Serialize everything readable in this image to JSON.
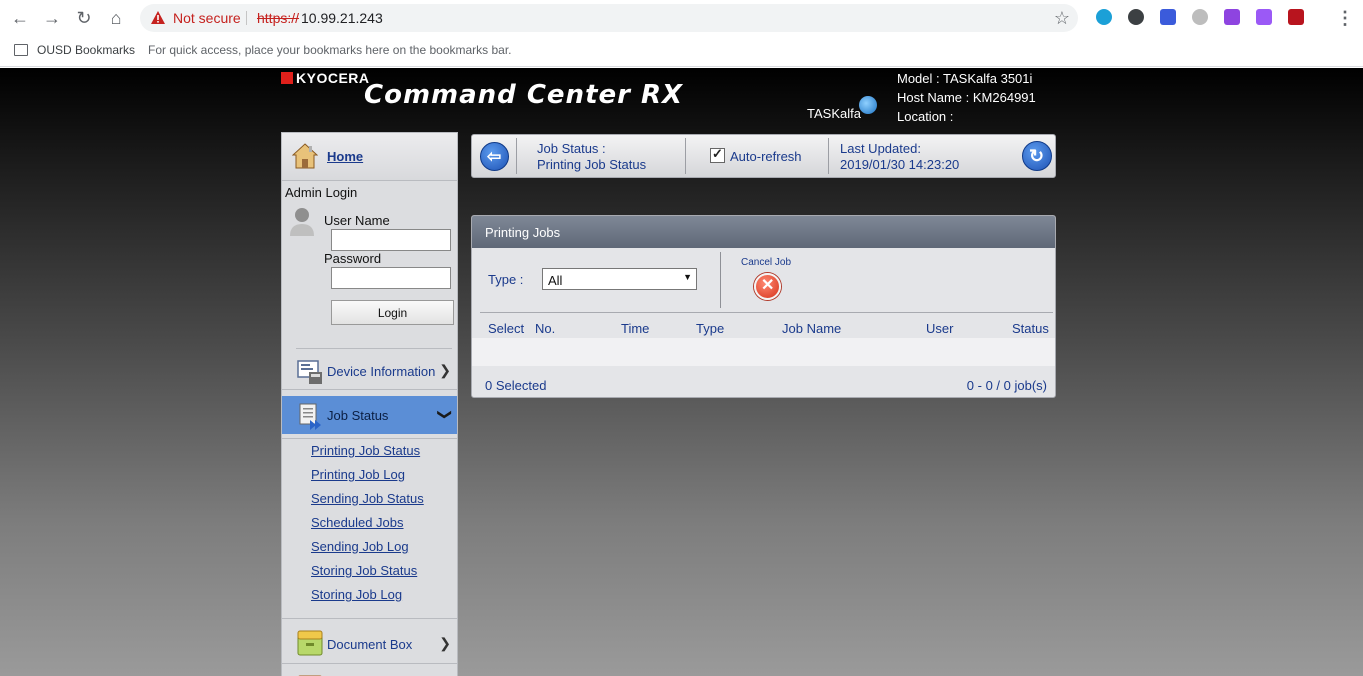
{
  "browser": {
    "security_label": "Not secure",
    "url_scheme": "https://",
    "url_host": "10.99.21.243",
    "bookmarks": {
      "folder": "OUSD Bookmarks",
      "hint": "For quick access, place your bookmarks here on the bookmarks bar."
    },
    "extension_colors": [
      "#1ba0d7",
      "#3c4043",
      "#3b5bdb",
      "#bdbdbd",
      "#8e44e0",
      "#9b59f6",
      "#b8141e"
    ]
  },
  "header": {
    "brand": "KYOCERA",
    "product": "Command Center RX",
    "series_logo": "TASKalfa",
    "model_label": "Model :",
    "model": "TASKalfa 3501i",
    "host_label": "Host Name :",
    "host": "KM264991",
    "location_label": "Location :",
    "location": ""
  },
  "sidebar": {
    "home": "Home",
    "admin_login": "Admin Login",
    "username_label": "User Name",
    "username_value": "",
    "password_label": "Password",
    "password_value": "",
    "login_button": "Login",
    "device_info": "Device Information",
    "job_status": "Job Status",
    "job_links": [
      "Printing Job Status",
      "Printing Job Log",
      "Sending Job Status",
      "Scheduled Jobs",
      "Sending Job Log",
      "Storing Job Status",
      "Storing Job Log"
    ],
    "document_box": "Document Box"
  },
  "status_bar": {
    "title_line1": "Job Status :",
    "title_line2": "Printing Job Status",
    "autorefresh_label": "Auto-refresh",
    "autorefresh_checked": true,
    "last_updated_label": "Last Updated:",
    "last_updated_value": "2019/01/30 14:23:20"
  },
  "jobs_panel": {
    "title": "Printing Jobs",
    "type_label": "Type :",
    "type_value": "All",
    "cancel_label": "Cancel Job",
    "columns": [
      "Select",
      "No.",
      "Time",
      "Type",
      "Job Name",
      "User",
      "Status"
    ],
    "rows": [],
    "selected_text": "0 Selected",
    "count_text": "0 - 0 / 0 job(s)"
  },
  "colors": {
    "link_blue": "#1a3a8c",
    "active_menu": "#5b8ed6",
    "panel_header": "#6b7482",
    "warning_red": "#c5221f"
  }
}
